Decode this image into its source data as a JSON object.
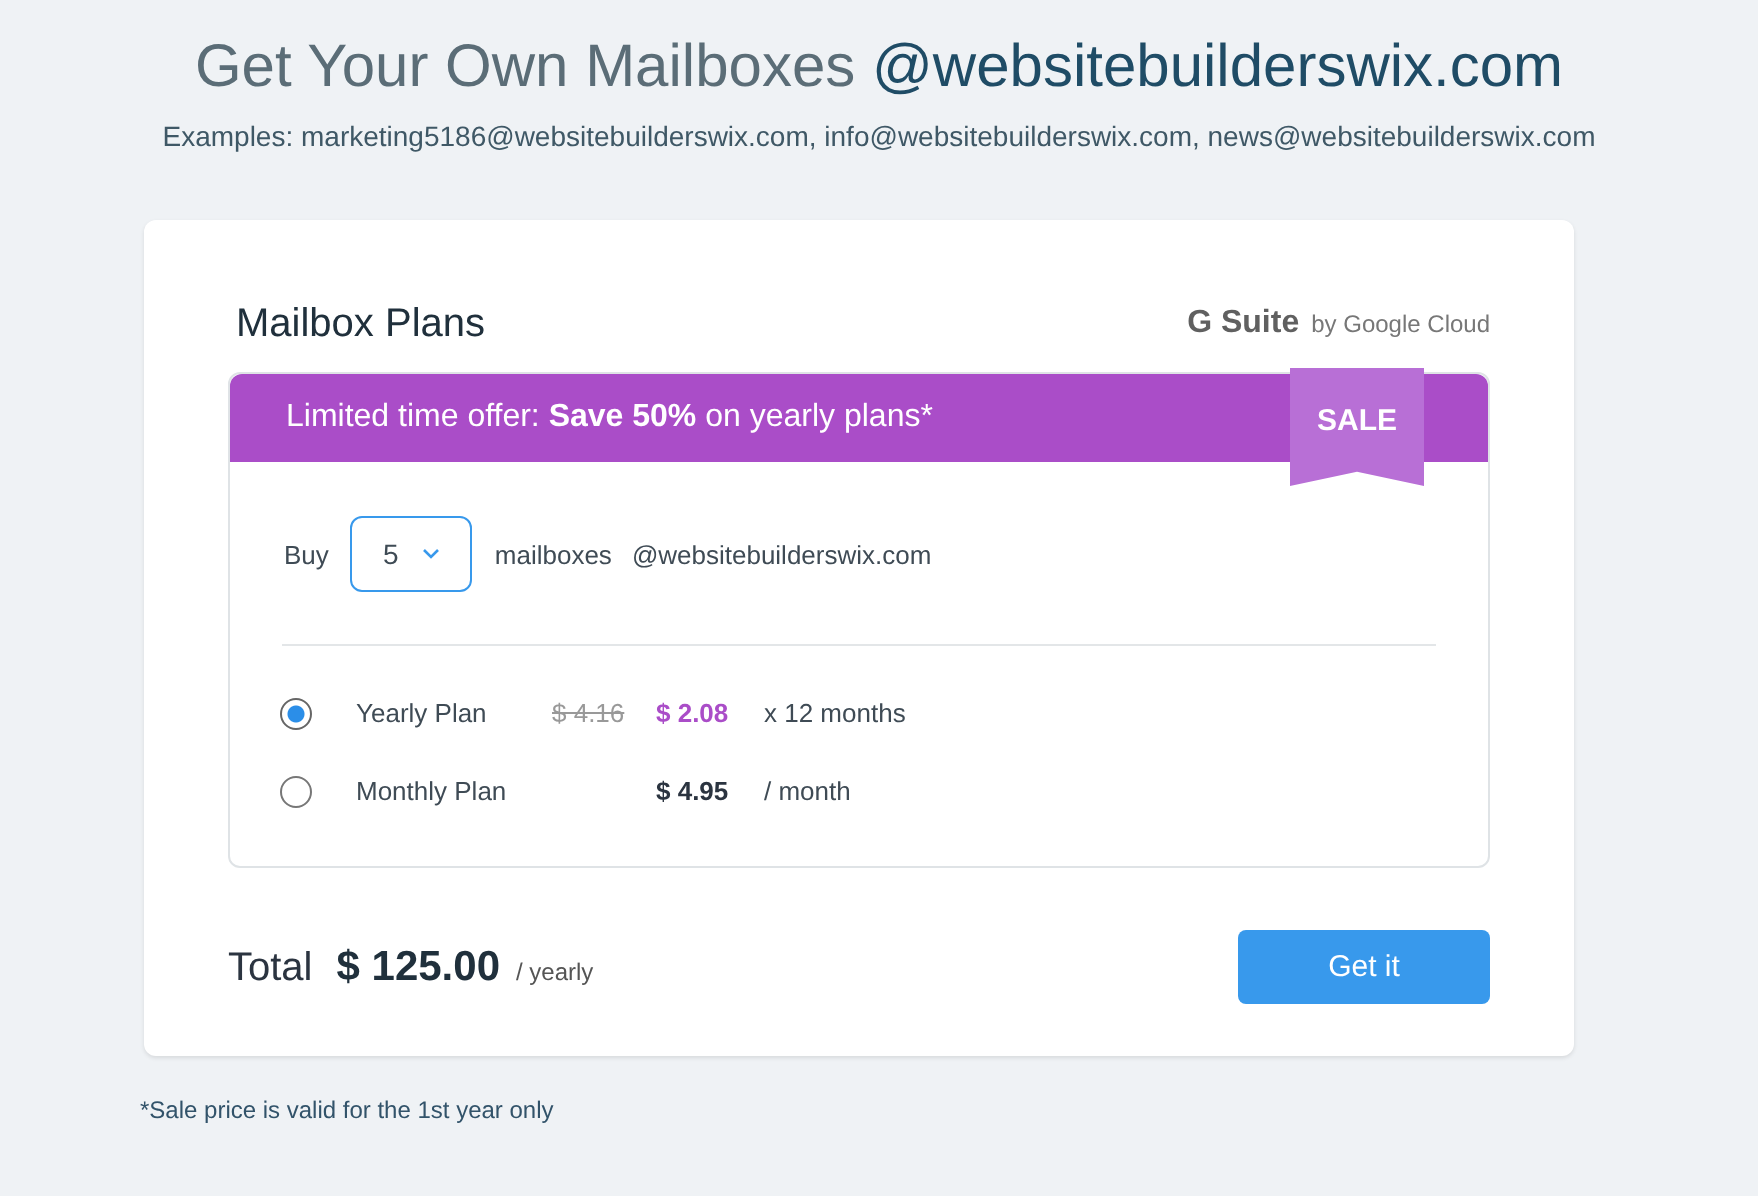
{
  "heading": {
    "text": "Get Your Own Mailboxes ",
    "domain": "@websitebuilderswix.com"
  },
  "examples": "Examples:  marketing5186@websitebuilderswix.com, info@websitebuilderswix.com, news@websitebuilderswix.com",
  "card": {
    "title": "Mailbox Plans",
    "brand": "G Suite",
    "brand_sub": "by Google Cloud",
    "offer": {
      "text": "Limited time offer: **Save 50%** on yearly plans*",
      "ribbon": "SALE"
    },
    "buy": {
      "label": "Buy",
      "quantity": "5",
      "unit": "mailboxes",
      "domain": "@websitebuilderswix.com"
    },
    "plans": [
      {
        "name": "Yearly Plan",
        "old_price": "$ 4.16",
        "price": "$ 2.08",
        "term": "x 12 months",
        "selected": true
      },
      {
        "name": "Monthly Plan",
        "price": "$ 4.95",
        "term": "/ month",
        "selected": false
      }
    ],
    "total": {
      "label": "Total",
      "amount": "$ 125.00",
      "period": "/ yearly"
    },
    "button": "Get it"
  },
  "footnote": "*Sale price is valid for the 1st year only"
}
